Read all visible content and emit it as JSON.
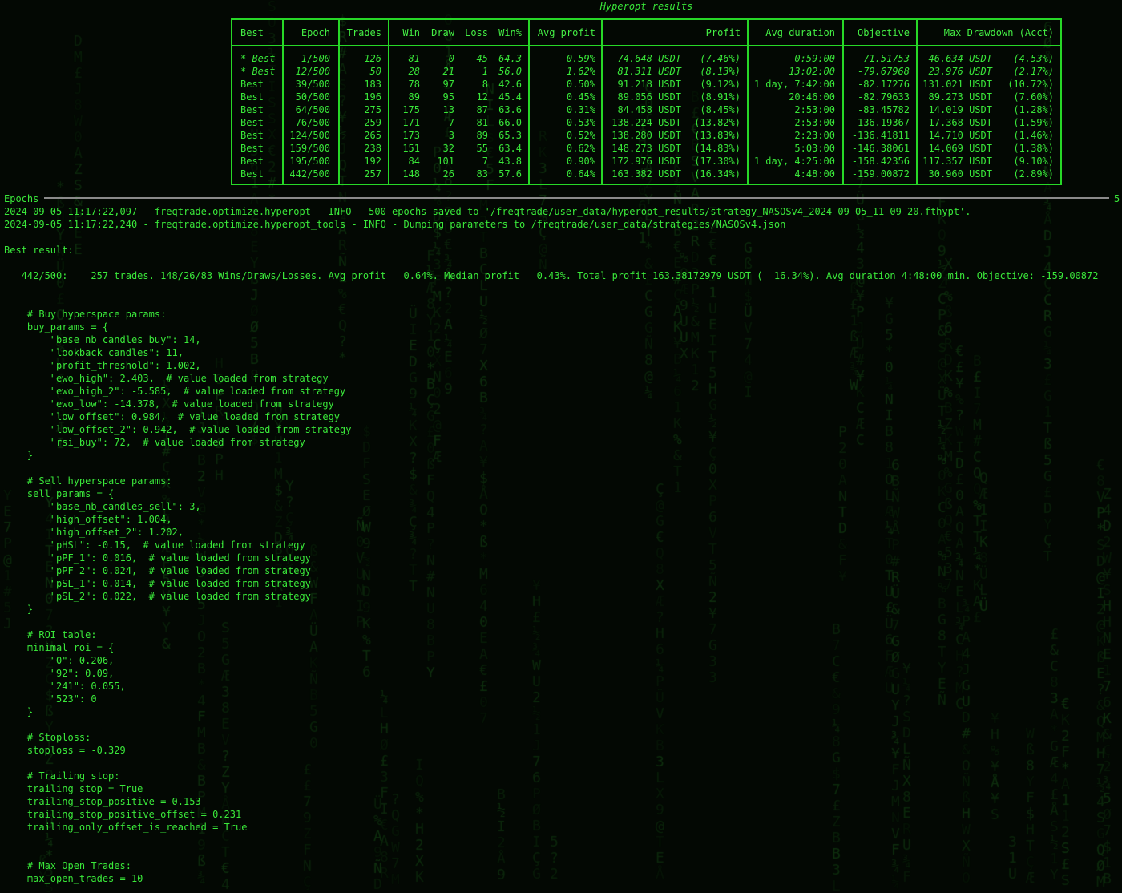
{
  "table": {
    "title": "Hyperopt results",
    "headers": [
      "Best",
      "Epoch",
      "Trades",
      "Win",
      "Draw",
      "Loss",
      "Win%",
      "Avg profit",
      "Profit",
      "Avg duration",
      "Objective",
      "Max Drawdown (Acct)"
    ],
    "rows": [
      {
        "best": "* Best",
        "epoch": "1/500",
        "trades": "126",
        "win": "81",
        "draw": "0",
        "loss": "45",
        "winpct": "64.3",
        "avg_profit": "0.59%",
        "profit": "74.648 USDT",
        "profit_pct": "(7.46%)",
        "avg_duration": "0:59:00",
        "objective": "-71.51753",
        "drawdown": "46.634 USDT",
        "drawdown_pct": "(4.53%)",
        "italic": true
      },
      {
        "best": "* Best",
        "epoch": "12/500",
        "trades": "50",
        "win": "28",
        "draw": "21",
        "loss": "1",
        "winpct": "56.0",
        "avg_profit": "1.62%",
        "profit": "81.311 USDT",
        "profit_pct": "(8.13%)",
        "avg_duration": "13:02:00",
        "objective": "-79.67968",
        "drawdown": "23.976 USDT",
        "drawdown_pct": "(2.17%)",
        "italic": true
      },
      {
        "best": "Best",
        "epoch": "39/500",
        "trades": "183",
        "win": "78",
        "draw": "97",
        "loss": "8",
        "winpct": "42.6",
        "avg_profit": "0.50%",
        "profit": "91.218 USDT",
        "profit_pct": "(9.12%)",
        "avg_duration": "1 day, 7:42:00",
        "objective": "-82.17276",
        "drawdown": "131.021 USDT",
        "drawdown_pct": "(10.72%)",
        "italic": false
      },
      {
        "best": "Best",
        "epoch": "50/500",
        "trades": "196",
        "win": "89",
        "draw": "95",
        "loss": "12",
        "winpct": "45.4",
        "avg_profit": "0.45%",
        "profit": "89.056 USDT",
        "profit_pct": "(8.91%)",
        "avg_duration": "20:46:00",
        "objective": "-82.79633",
        "drawdown": "89.273 USDT",
        "drawdown_pct": "(7.60%)",
        "italic": false
      },
      {
        "best": "Best",
        "epoch": "64/500",
        "trades": "275",
        "win": "175",
        "draw": "13",
        "loss": "87",
        "winpct": "63.6",
        "avg_profit": "0.31%",
        "profit": "84.458 USDT",
        "profit_pct": "(8.45%)",
        "avg_duration": "2:53:00",
        "objective": "-83.45782",
        "drawdown": "14.019 USDT",
        "drawdown_pct": "(1.28%)",
        "italic": false
      },
      {
        "best": "Best",
        "epoch": "76/500",
        "trades": "259",
        "win": "171",
        "draw": "7",
        "loss": "81",
        "winpct": "66.0",
        "avg_profit": "0.53%",
        "profit": "138.224 USDT",
        "profit_pct": "(13.82%)",
        "avg_duration": "2:53:00",
        "objective": "-136.19367",
        "drawdown": "17.368 USDT",
        "drawdown_pct": "(1.59%)",
        "italic": false
      },
      {
        "best": "Best",
        "epoch": "124/500",
        "trades": "265",
        "win": "173",
        "draw": "3",
        "loss": "89",
        "winpct": "65.3",
        "avg_profit": "0.52%",
        "profit": "138.280 USDT",
        "profit_pct": "(13.83%)",
        "avg_duration": "2:23:00",
        "objective": "-136.41811",
        "drawdown": "14.710 USDT",
        "drawdown_pct": "(1.46%)",
        "italic": false
      },
      {
        "best": "Best",
        "epoch": "159/500",
        "trades": "238",
        "win": "151",
        "draw": "32",
        "loss": "55",
        "winpct": "63.4",
        "avg_profit": "0.62%",
        "profit": "148.273 USDT",
        "profit_pct": "(14.83%)",
        "avg_duration": "5:03:00",
        "objective": "-146.38061",
        "drawdown": "14.069 USDT",
        "drawdown_pct": "(1.38%)",
        "italic": false
      },
      {
        "best": "Best",
        "epoch": "195/500",
        "trades": "192",
        "win": "84",
        "draw": "101",
        "loss": "7",
        "winpct": "43.8",
        "avg_profit": "0.90%",
        "profit": "172.976 USDT",
        "profit_pct": "(17.30%)",
        "avg_duration": "1 day, 4:25:00",
        "objective": "-158.42356",
        "drawdown": "117.357 USDT",
        "drawdown_pct": "(9.10%)",
        "italic": false
      },
      {
        "best": "Best",
        "epoch": "442/500",
        "trades": "257",
        "win": "148",
        "draw": "26",
        "loss": "83",
        "winpct": "57.6",
        "avg_profit": "0.64%",
        "profit": "163.382 USDT",
        "profit_pct": "(16.34%)",
        "avg_duration": "4:48:00",
        "objective": "-159.00872",
        "drawdown": "30.960 USDT",
        "drawdown_pct": "(2.89%)",
        "italic": false
      }
    ]
  },
  "epochs": {
    "label": "Epochs",
    "right_text": "5"
  },
  "log_lines": [
    "2024-09-05 11:17:22,097 - freqtrade.optimize.hyperopt - INFO - 500 epochs saved to '/freqtrade/user_data/hyperopt_results/strategy_NASOSv4_2024-09-05_11-09-20.fthypt'.",
    "2024-09-05 11:17:22,240 - freqtrade.optimize.hyperopt_tools - INFO - Dumping parameters to /freqtrade/user_data/strategies/NASOSv4.json",
    "",
    "Best result:",
    "",
    "   442/500:    257 trades. 148/26/83 Wins/Draws/Losses. Avg profit   0.64%. Median profit   0.43%. Total profit 163.38172979 USDT (  16.34%). Avg duration 4:48:00 min. Objective: -159.00872",
    "",
    "",
    "    # Buy hyperspace params:",
    "    buy_params = {",
    "        \"base_nb_candles_buy\": 14,",
    "        \"lookback_candles\": 11,",
    "        \"profit_threshold\": 1.002,",
    "        \"ewo_high\": 2.403,  # value loaded from strategy",
    "        \"ewo_high_2\": -5.585,  # value loaded from strategy",
    "        \"ewo_low\": -14.378,  # value loaded from strategy",
    "        \"low_offset\": 0.984,  # value loaded from strategy",
    "        \"low_offset_2\": 0.942,  # value loaded from strategy",
    "        \"rsi_buy\": 72,  # value loaded from strategy",
    "    }",
    "",
    "    # Sell hyperspace params:",
    "    sell_params = {",
    "        \"base_nb_candles_sell\": 3,",
    "        \"high_offset\": 1.004,",
    "        \"high_offset_2\": 1.202,",
    "        \"pHSL\": -0.15,  # value loaded from strategy",
    "        \"pPF_1\": 0.016,  # value loaded from strategy",
    "        \"pPF_2\": 0.024,  # value loaded from strategy",
    "        \"pSL_1\": 0.014,  # value loaded from strategy",
    "        \"pSL_2\": 0.022,  # value loaded from strategy",
    "    }",
    "",
    "    # ROI table:",
    "    minimal_roi = {",
    "        \"0\": 0.206,",
    "        \"92\": 0.09,",
    "        \"241\": 0.055,",
    "        \"523\": 0",
    "    }",
    "",
    "    # Stoploss:",
    "    stoploss = -0.329",
    "",
    "    # Trailing stop:",
    "    trailing_stop = True",
    "    trailing_stop_positive = 0.153",
    "    trailing_stop_positive_offset = 0.231",
    "    trailing_only_offset_is_reached = True",
    "",
    "",
    "    # Max Open Trades:",
    "    max_open_trades = 10"
  ],
  "theme": {
    "text_color": "#39e639",
    "border_color": "#27d827",
    "background": "#030803",
    "rain_color": "#1f5a1f"
  }
}
